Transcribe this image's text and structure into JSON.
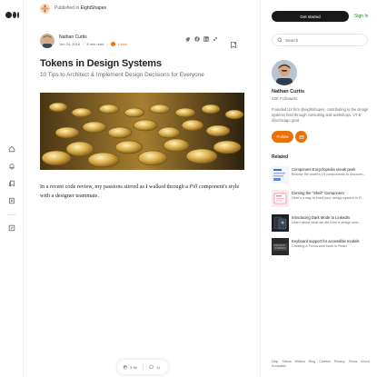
{
  "publication": {
    "prefix": "Published in",
    "name": "EightShapes"
  },
  "author": {
    "name": "Nathan Curtis",
    "date": "Jun 24, 2016",
    "sep": "·",
    "read_time": "8 min read",
    "listen_label": "Listen"
  },
  "article": {
    "title": "Tokens in Design Systems",
    "subtitle": "10 Tips to Architect & Implement Design Decisions for Everyone",
    "body_part1": "In a recent code review, my passions stirred as I walked through a ",
    "body_italic": "Pill",
    "body_part2": " component's style with a designer teammate."
  },
  "engagement": {
    "claps": "3.9K",
    "responses": "11"
  },
  "sidebar": {
    "get_started": "Get started",
    "sign_in": "Sign In",
    "search_placeholder": "Search",
    "profile_name": "Nathan Curtis",
    "followers": "22K Followers",
    "bio": "Founded UX firm @eightshapes, contributing to the design systems field through consulting and workshops. VT & @uchicago grad.",
    "follow_label": "Follow",
    "related_heading": "Related",
    "related": [
      {
        "title": "Component Encyclopedia sneak peek",
        "desc": "Browse the world's 10 components to discover..."
      },
      {
        "title": "Coming the \"Shell\" Component",
        "desc": "Here's a way to build your design system in Fi..."
      },
      {
        "title": "Introducing Dark Mode to LinkedIn",
        "desc": "Learn about what we did from a design and..."
      },
      {
        "title": "Keyboard support for accessible modals",
        "desc": "Creating a Focus lock hook in React"
      }
    ],
    "footer": [
      "Help",
      "Status",
      "Writers",
      "Blog",
      "Careers",
      "Privacy",
      "Terms",
      "About",
      "Knowable"
    ]
  },
  "colors": {
    "accent": "#e8710a",
    "sign_in": "#1a8917",
    "text": "#242424",
    "muted": "#6b6b6b"
  },
  "icons": {
    "rail": [
      "home-icon",
      "bell-icon",
      "bookmarks-icon",
      "stories-icon",
      "write-icon"
    ],
    "share": [
      "twitter-icon",
      "facebook-icon",
      "linkedin-icon",
      "link-icon"
    ]
  }
}
